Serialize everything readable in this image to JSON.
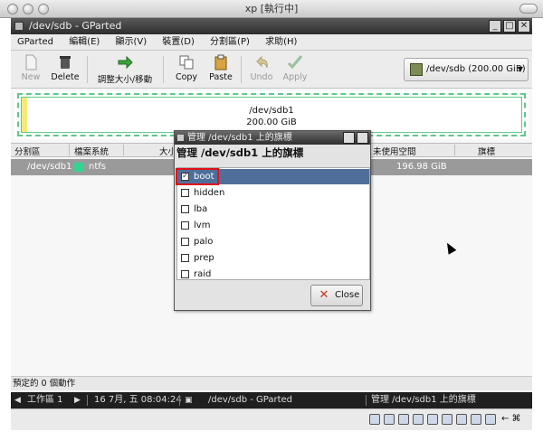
{
  "mac": {
    "title": "xp [執行中]"
  },
  "app": {
    "title": "/dev/sdb - GParted",
    "menus": [
      "GParted",
      "編輯(E)",
      "顯示(V)",
      "裝置(D)",
      "分割區(P)",
      "求助(H)"
    ],
    "toolbar": {
      "new": "New",
      "delete": "Delete",
      "resize": "調整大小/移動",
      "copy": "Copy",
      "paste": "Paste",
      "undo": "Undo",
      "apply": "Apply"
    },
    "device_selector": "/dev/sdb  (200.00 GiB)",
    "visual": {
      "name": "/dev/sdb1",
      "size": "200.00 GiB"
    },
    "columns": {
      "partition": "分割區",
      "filesystem": "檔案系統",
      "size": "大小",
      "unused": "未使用空間",
      "flags": "旗標"
    },
    "partition_row": {
      "name": "/dev/sdb1",
      "filesystem": "ntfs",
      "unused": "196.98 GiB"
    },
    "status": "預定的 0 個動作"
  },
  "dialog": {
    "title": "管理 /dev/sdb1 上的旗標",
    "heading": "管理 /dev/sdb1 上的旗標",
    "flags": [
      {
        "label": "boot",
        "checked": true
      },
      {
        "label": "hidden",
        "checked": false
      },
      {
        "label": "lba",
        "checked": false
      },
      {
        "label": "lvm",
        "checked": false
      },
      {
        "label": "palo",
        "checked": false
      },
      {
        "label": "prep",
        "checked": false
      },
      {
        "label": "raid",
        "checked": false
      }
    ],
    "close_label": "Close"
  },
  "panel": {
    "workspace": "工作區 1",
    "clock": "16 7月, 五 08:04:24",
    "task1": "/dev/sdb - GParted",
    "task2": "管理 /dev/sdb1 上的旗標"
  }
}
